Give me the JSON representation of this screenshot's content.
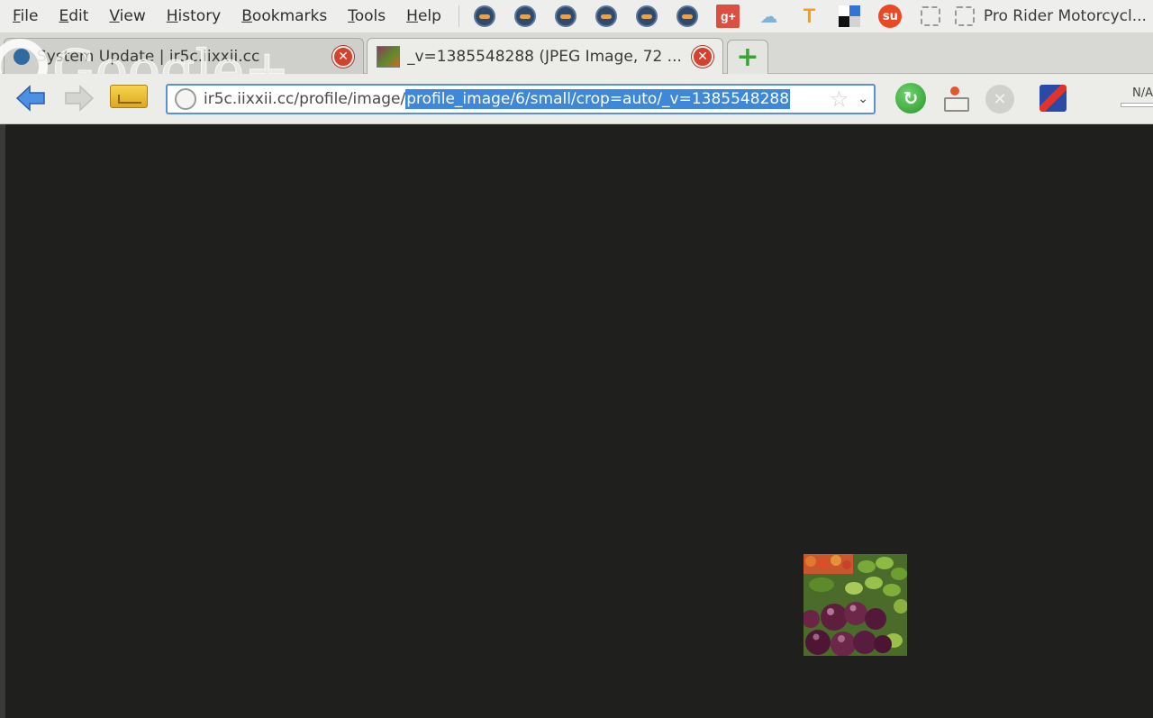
{
  "menubar": {
    "items": [
      "File",
      "Edit",
      "View",
      "History",
      "Bookmarks",
      "Tools",
      "Help"
    ],
    "toolbar_icons": [
      "addon-circle-icon",
      "addon-circle-icon",
      "addon-circle-icon",
      "addon-circle-icon",
      "addon-circle-icon",
      "addon-circle-icon",
      "google-plus-icon",
      "cloud-icon",
      "t-icon",
      "delicious-icon",
      "stumbleupon-icon",
      "dashed-box-icon"
    ],
    "gplus_text": "g+",
    "t_text": "T",
    "stumble_text": "su",
    "bookmark_label": "Pro Rider Motorcycl..."
  },
  "tabs": [
    {
      "title": "System Update | ir5c.iixxii.cc",
      "active": false
    },
    {
      "title": "_v=1385548288 (JPEG Image, 72 ...",
      "active": true
    }
  ],
  "watermark": "Google+",
  "navbar": {
    "url_prefix": "ir5c.iixxii.cc/profile/image/",
    "url_selected": "profile_image/6/small/crop=auto/_v=1385548288",
    "zoom_label": "N/A"
  },
  "colors": {
    "content_bg": "#1f1f1d",
    "selection": "#3e87d9",
    "close": "#d6412e",
    "new_tab": "#3aa23a"
  }
}
